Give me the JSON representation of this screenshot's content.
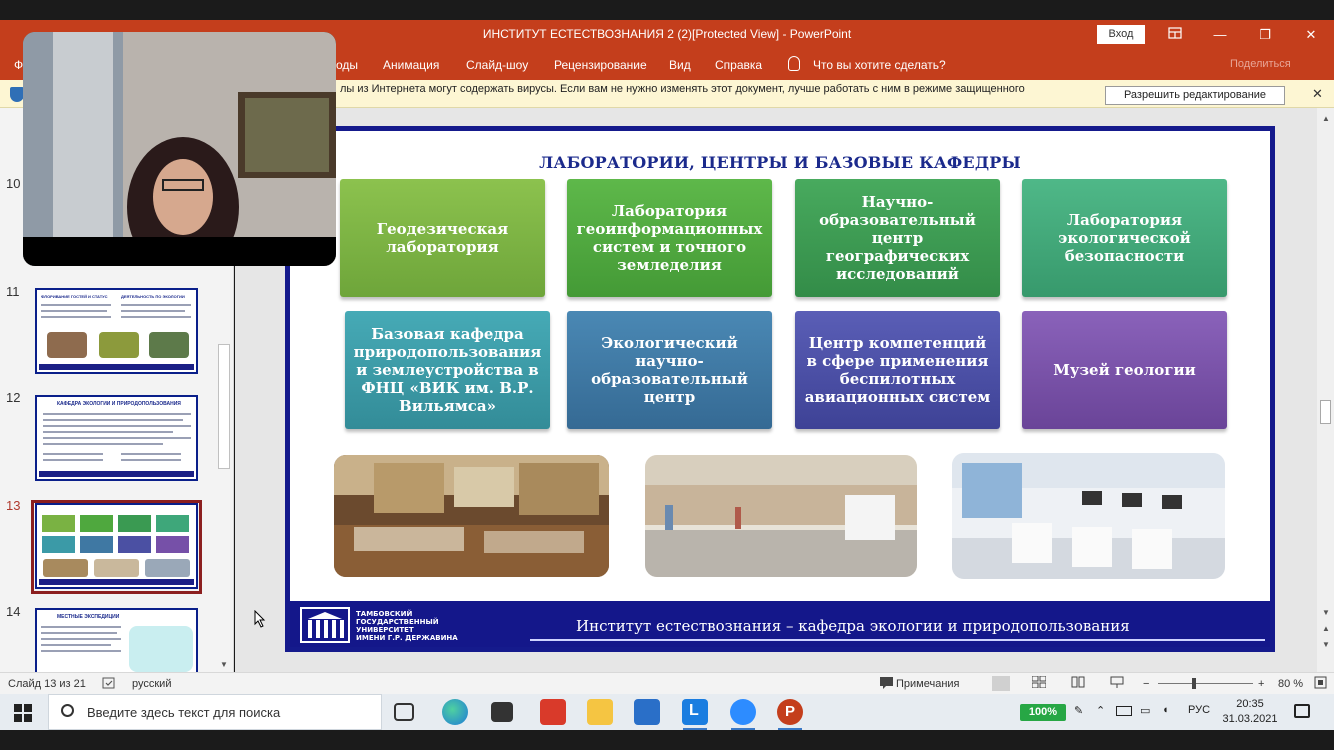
{
  "window": {
    "title": "ИНСТИТУТ ЕСТЕСТВОЗНАНИЯ 2 (2)[Protected View]  -  PowerPoint",
    "signin_label": "Вход",
    "restore_icon": "restore-icon",
    "minimize_symbol": "—",
    "maximize_symbol": "❐",
    "close_symbol": "✕"
  },
  "ribbon": {
    "file_label": "Ф",
    "tabs": [
      "оды",
      "Анимация",
      "Слайд-шоу",
      "Рецензирование",
      "Вид",
      "Справка"
    ],
    "tell_me": "Что вы хотите сделать?",
    "share_label": "Поделиться"
  },
  "message_bar": {
    "text": "лы из Интернета могут содержать вирусы. Если вам не нужно изменять этот документ, лучше работать с ним в режиме защищенного",
    "enable_button": "Разрешить редактирование",
    "close_symbol": "✕"
  },
  "thumbnails": {
    "numbers": [
      "10",
      "11",
      "12",
      "13",
      "14"
    ],
    "active": "13",
    "thumb11_title_left": "ФЛОРИВАНИЕ ГОСТЕЙ И СТАТУС",
    "thumb11_title_right": "ДЕЯТЕЛЬНОСТЬ ПО ЭКОЛОГИИ",
    "thumb12_title": "КАФЕДРА ЭКОЛОГИИ И ПРИРОДОПОЛЬЗОВАНИЯ",
    "thumb14_title": "МЕСТНЫЕ ЭКСПЕДИЦИИ"
  },
  "slide": {
    "title": "ЛАБОРАТОРИИ, ЦЕНТРЫ И БАЗОВЫЕ КАФЕДРЫ",
    "boxes": [
      {
        "label": "Геодезическая лаборатория",
        "color": "#7ab243"
      },
      {
        "label": "Лаборатория геоинформационных систем и точного земледелия",
        "color": "#4fa83e"
      },
      {
        "label": "Научно-образовательный центр географических исследований",
        "color": "#3a9a52"
      },
      {
        "label": "Лаборатория экологической безопасности",
        "color": "#3ea77a"
      },
      {
        "label": "Базовая кафедра природопользования и землеустройства в ФНЦ «ВИК им. В.Р. Вильямса»",
        "color": "#3b9aa7"
      },
      {
        "label": "Экологический научно-образовательный центр",
        "color": "#3f78a3"
      },
      {
        "label": "Центр компетенций в сфере применения беспилотных авиационных систем",
        "color": "#4b50a3"
      },
      {
        "label": "Музей геологии",
        "color": "#7650a8"
      }
    ],
    "university": [
      "ТАМБОВСКИЙ",
      "ГОСУДАРСТВЕННЫЙ",
      "УНИВЕРСИТЕТ",
      "ИМЕНИ Г.Р. ДЕРЖАВИНА"
    ],
    "footer_text": "Институт естествознания – кафедра экологии и природопользования"
  },
  "status": {
    "slide_info": "Слайд 13 из 21",
    "language": "русский",
    "comments": "Примечания",
    "zoom_minus": "−",
    "zoom_plus": "+",
    "zoom": "80 %"
  },
  "taskbar": {
    "search_placeholder": "Введите здесь текст для поиска",
    "battery": "100%",
    "lang": "РУС",
    "time": "20:35",
    "date": "31.03.2021"
  },
  "colors": {
    "powerpoint_red": "#c43e1c",
    "slide_border": "#151a8c",
    "slide_title": "#1b2a8c"
  }
}
